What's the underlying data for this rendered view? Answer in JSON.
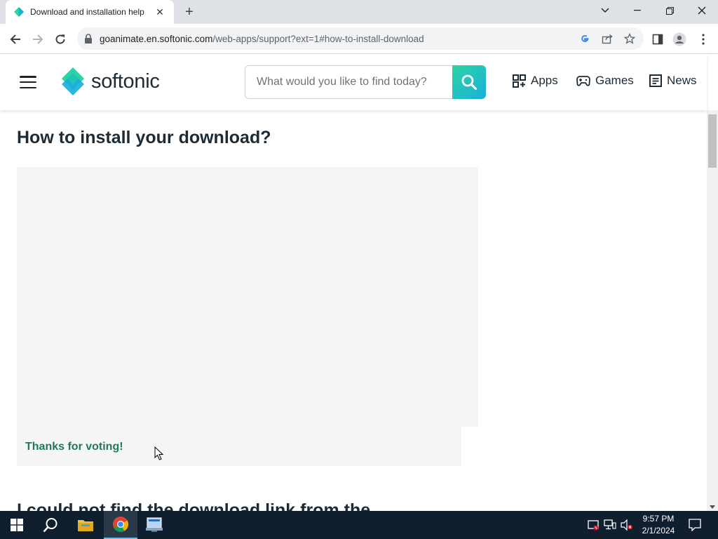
{
  "browser": {
    "tab": {
      "title": "Download and installation help",
      "close_glyph": "✕"
    },
    "new_tab_glyph": "+",
    "url": {
      "host": "goanimate.en.softonic.com",
      "path": "/web-apps/support?ext=1#how-to-install-download"
    },
    "window_controls": [
      "chevron-down-icon",
      "minimize-icon",
      "restore-icon",
      "close-icon"
    ]
  },
  "site": {
    "logo_text": "softonic",
    "search_placeholder": "What would you like to find today?",
    "nav": [
      {
        "label": "Apps",
        "icon": "apps-grid-icon"
      },
      {
        "label": "Games",
        "icon": "gamepad-icon"
      },
      {
        "label": "News",
        "icon": "newspaper-icon"
      }
    ],
    "accent_colors": [
      "#2bd4a4",
      "#1ab0d9"
    ]
  },
  "content": {
    "heading": "How to install your download?",
    "thanks_message": "Thanks for voting!",
    "next_heading": "I could not find the download link from the"
  },
  "taskbar": {
    "apps": [
      "start-icon",
      "search-icon",
      "file-explorer-icon",
      "chrome-icon",
      "network-app-icon"
    ],
    "clock": {
      "time": "9:57 PM",
      "date": "2/1/2024"
    }
  }
}
